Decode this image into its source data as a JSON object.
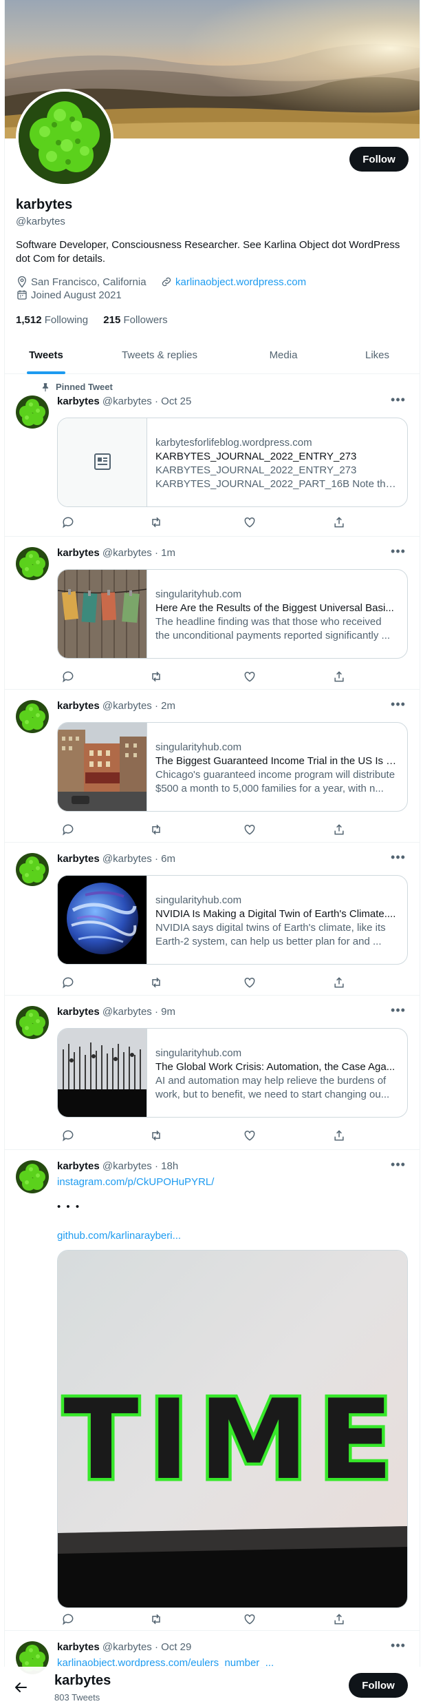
{
  "profile": {
    "name": "karbytes",
    "handle": "@karbytes",
    "bio": "Software Developer, Consciousness Researcher. See Karlina Object dot WordPress dot Com for details.",
    "location": "San Francisco, California",
    "website": "karlinaobject.wordpress.com",
    "joined": "Joined August 2021",
    "following_count": "1,512",
    "following_label": "Following",
    "followers_count": "215",
    "followers_label": "Followers",
    "follow_label": "Follow"
  },
  "tabs": [
    "Tweets",
    "Tweets & replies",
    "Media",
    "Likes"
  ],
  "pinned_label": "Pinned Tweet",
  "tweets": [
    {
      "name": "karbytes",
      "handle": "@karbytes",
      "time": "· Oct 25",
      "card": {
        "domain": "karbytesforlifeblog.wordpress.com",
        "title": "KARBYTES_JOURNAL_2022_ENTRY_273",
        "desc": "KARBYTES_JOURNAL_2022_ENTRY_273 KARBYTES_JOURNAL_2022_PART_16B Note that ...",
        "desc1": "KARBYTES_JOURNAL_2022_ENTRY_273",
        "desc2": "KARBYTES_JOURNAL_2022_PART_16B Note that ..."
      }
    },
    {
      "name": "karbytes",
      "handle": "@karbytes",
      "time": "· 1m",
      "card": {
        "domain": "singularityhub.com",
        "title": "Here Are the Results of the Biggest Universal Basi...",
        "desc1": "The headline finding was that those who received",
        "desc2": "the unconditional payments reported significantly ..."
      }
    },
    {
      "name": "karbytes",
      "handle": "@karbytes",
      "time": "· 2m",
      "card": {
        "domain": "singularityhub.com",
        "title": "The Biggest Guaranteed Income Trial in the US Is L...",
        "desc1": "Chicago's guaranteed income program will distribute",
        "desc2": "$500 a month to 5,000 families for a year, with n..."
      }
    },
    {
      "name": "karbytes",
      "handle": "@karbytes",
      "time": "· 6m",
      "card": {
        "domain": "singularityhub.com",
        "title": "NVIDIA Is Making a Digital Twin of Earth's Climate....",
        "desc1": "NVIDIA says digital twins of Earth's climate, like its",
        "desc2": "Earth-2 system, can help us better plan for and ..."
      }
    },
    {
      "name": "karbytes",
      "handle": "@karbytes",
      "time": "· 9m",
      "card": {
        "domain": "singularityhub.com",
        "title": "The Global Work Crisis: Automation, the Case Aga...",
        "desc1": "AI and automation may help relieve the burdens of",
        "desc2": "work, but to benefit, we need to start changing ou..."
      }
    },
    {
      "name": "karbytes",
      "handle": "@karbytes",
      "time": "· 18h",
      "link1": "instagram.com/p/CkUPOHuPYRL/",
      "ellipsis": "• • •",
      "link2": "github.com/karlinarayberi...",
      "photo_text": "TIME"
    },
    {
      "name": "karbytes",
      "handle": "@karbytes",
      "time": "· Oct 29",
      "link1": "karlinaobject.wordpress.com/eulers_number_..."
    }
  ],
  "more_icon": "•••",
  "bottom_bar": {
    "name": "karbytes",
    "tweet_count": "803 Tweets",
    "follow_label": "Follow"
  },
  "colors": {
    "accent": "#1d9bf0",
    "text": "#0f1419",
    "muted": "#536471",
    "avatar_green": "#5bd11c"
  }
}
